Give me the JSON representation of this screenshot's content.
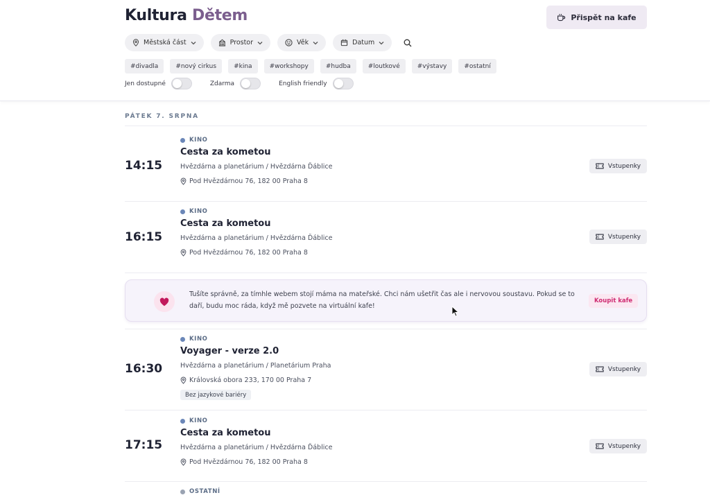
{
  "header": {
    "title_part1": "Kultura",
    "title_part2": "Dětem",
    "coffee_button": "Přispět na kafe",
    "filters": [
      {
        "label": "Městská část",
        "icon": "location-pin-icon"
      },
      {
        "label": "Prostor",
        "icon": "building-icon"
      },
      {
        "label": "Věk",
        "icon": "face-icon"
      },
      {
        "label": "Datum",
        "icon": "calendar-icon"
      }
    ],
    "tags": [
      "#divadla",
      "#nový cirkus",
      "#kina",
      "#workshopy",
      "#hudba",
      "#loutkové",
      "#výstavy",
      "#ostatní"
    ],
    "toggles": [
      {
        "label": "Jen dostupné",
        "on": false
      },
      {
        "label": "Zdarma",
        "on": false
      },
      {
        "label": "English friendly",
        "on": false
      }
    ]
  },
  "day_heading": "PÁTEK 7. SRPNA",
  "ticket_label": "Vstupenky",
  "events": [
    {
      "time": "14:15",
      "category": "KINO",
      "name": "Cesta za kometou",
      "venue": "Hvězdárna a planetárium / Hvězdárna Ďáblice",
      "address": "Pod Hvězdárnou 76, 182 00 Praha 8"
    },
    {
      "time": "16:15",
      "category": "KINO",
      "name": "Cesta za kometou",
      "venue": "Hvězdárna a planetárium / Hvězdárna Ďáblice",
      "address": "Pod Hvězdárnou 76, 182 00 Praha 8"
    },
    {
      "time": "16:30",
      "category": "KINO",
      "name": "Voyager - verze 2.0",
      "venue": "Hvězdárna a planetárium / Planetárium Praha",
      "address": "Královská obora 233, 170 00 Praha 7",
      "badge": "Bez jazykové bariéry"
    },
    {
      "time": "17:15",
      "category": "KINO",
      "name": "Cesta za kometou",
      "venue": "Hvězdárna a planetárium / Hvězdárna Ďáblice",
      "address": "Pod Hvězdárnou 76, 182 00 Praha 8"
    }
  ],
  "next_category": "OSTATNÍ",
  "promo": {
    "text": "Tušíte správně, za tímhle webem stojí máma na mateřské. Chci nám ušetřit čas ale i nervovou soustavu. Pokud se to daří, budu moc ráda, když mě pozvete na virtuální kafe!",
    "button": "Koupit kafe"
  },
  "colors": {
    "accent": "#7b5e8e",
    "category_dot": "#6b87b8",
    "promo_button": "#cf2c72",
    "heart": "#c2185b"
  }
}
